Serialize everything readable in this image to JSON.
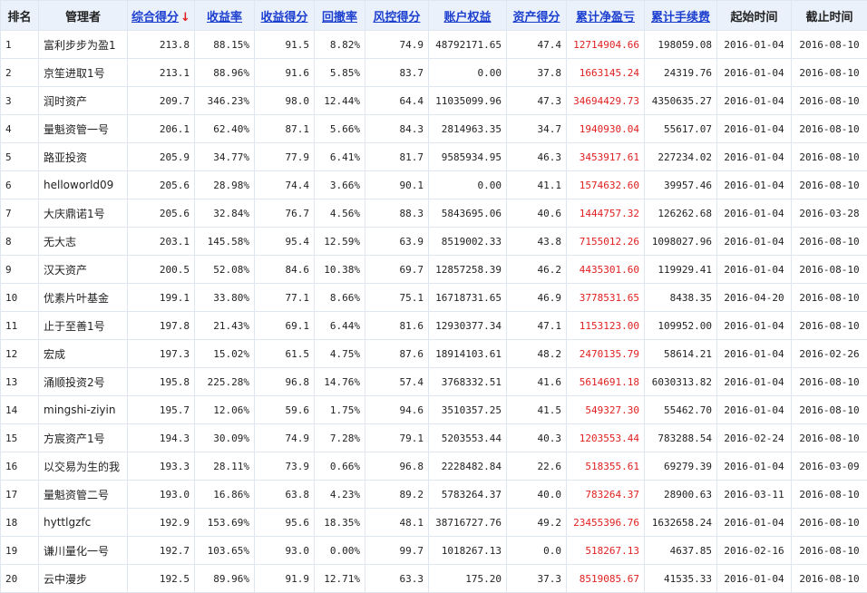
{
  "columns": [
    {
      "label": "排名",
      "sortable": false
    },
    {
      "label": "管理者",
      "sortable": false
    },
    {
      "label": "综合得分",
      "sortable": true,
      "active_sort": "desc"
    },
    {
      "label": "收益率",
      "sortable": true
    },
    {
      "label": "收益得分",
      "sortable": true
    },
    {
      "label": "回撤率",
      "sortable": true
    },
    {
      "label": "风控得分",
      "sortable": true
    },
    {
      "label": "账户权益",
      "sortable": true
    },
    {
      "label": "资产得分",
      "sortable": true
    },
    {
      "label": "累计净盈亏",
      "sortable": true
    },
    {
      "label": "累计手续费",
      "sortable": true
    },
    {
      "label": "起始时间",
      "sortable": false
    },
    {
      "label": "截止时间",
      "sortable": false
    }
  ],
  "sort_arrow": "↓",
  "colors": {
    "link": "#1d3fcf",
    "profit": "#e02020",
    "header_bg": "#eaf1fa",
    "border": "#dfe6ef"
  },
  "rows": [
    [
      "1",
      "富利步步为盈1",
      "213.8",
      "88.15%",
      "91.5",
      "8.82%",
      "74.9",
      "48792171.65",
      "47.4",
      "12714904.66",
      "198059.08",
      "2016-01-04",
      "2016-08-10"
    ],
    [
      "2",
      "京笙进取1号",
      "213.1",
      "88.96%",
      "91.6",
      "5.85%",
      "83.7",
      "0.00",
      "37.8",
      "1663145.24",
      "24319.76",
      "2016-01-04",
      "2016-08-10"
    ],
    [
      "3",
      "润时资产",
      "209.7",
      "346.23%",
      "98.0",
      "12.44%",
      "64.4",
      "11035099.96",
      "47.3",
      "34694429.73",
      "4350635.27",
      "2016-01-04",
      "2016-08-10"
    ],
    [
      "4",
      "量魁资管一号",
      "206.1",
      "62.40%",
      "87.1",
      "5.66%",
      "84.3",
      "2814963.35",
      "34.7",
      "1940930.04",
      "55617.07",
      "2016-01-04",
      "2016-08-10"
    ],
    [
      "5",
      "路亚投资",
      "205.9",
      "34.77%",
      "77.9",
      "6.41%",
      "81.7",
      "9585934.95",
      "46.3",
      "3453917.61",
      "227234.02",
      "2016-01-04",
      "2016-08-10"
    ],
    [
      "6",
      "helloworld09",
      "205.6",
      "28.98%",
      "74.4",
      "3.66%",
      "90.1",
      "0.00",
      "41.1",
      "1574632.60",
      "39957.46",
      "2016-01-04",
      "2016-08-10"
    ],
    [
      "7",
      "大庆鼎诺1号",
      "205.6",
      "32.84%",
      "76.7",
      "4.56%",
      "88.3",
      "5843695.06",
      "40.6",
      "1444757.32",
      "126262.68",
      "2016-01-04",
      "2016-03-28"
    ],
    [
      "8",
      "无大志",
      "203.1",
      "145.58%",
      "95.4",
      "12.59%",
      "63.9",
      "8519002.33",
      "43.8",
      "7155012.26",
      "1098027.96",
      "2016-01-04",
      "2016-08-10"
    ],
    [
      "9",
      "汉天资产",
      "200.5",
      "52.08%",
      "84.6",
      "10.38%",
      "69.7",
      "12857258.39",
      "46.2",
      "4435301.60",
      "119929.41",
      "2016-01-04",
      "2016-08-10"
    ],
    [
      "10",
      "优素片叶基金",
      "199.1",
      "33.80%",
      "77.1",
      "8.66%",
      "75.1",
      "16718731.65",
      "46.9",
      "3778531.65",
      "8438.35",
      "2016-04-20",
      "2016-08-10"
    ],
    [
      "11",
      "止于至善1号",
      "197.8",
      "21.43%",
      "69.1",
      "6.44%",
      "81.6",
      "12930377.34",
      "47.1",
      "1153123.00",
      "109952.00",
      "2016-01-04",
      "2016-08-10"
    ],
    [
      "12",
      "宏成",
      "197.3",
      "15.02%",
      "61.5",
      "4.75%",
      "87.6",
      "18914103.61",
      "48.2",
      "2470135.79",
      "58614.21",
      "2016-01-04",
      "2016-02-26"
    ],
    [
      "13",
      "涌顺投资2号",
      "195.8",
      "225.28%",
      "96.8",
      "14.76%",
      "57.4",
      "3768332.51",
      "41.6",
      "5614691.18",
      "6030313.82",
      "2016-01-04",
      "2016-08-10"
    ],
    [
      "14",
      "mingshi-ziyin",
      "195.7",
      "12.06%",
      "59.6",
      "1.75%",
      "94.6",
      "3510357.25",
      "41.5",
      "549327.30",
      "55462.70",
      "2016-01-04",
      "2016-08-10"
    ],
    [
      "15",
      "方宸资产1号",
      "194.3",
      "30.09%",
      "74.9",
      "7.28%",
      "79.1",
      "5203553.44",
      "40.3",
      "1203553.44",
      "783288.54",
      "2016-02-24",
      "2016-08-10"
    ],
    [
      "16",
      "以交易为生的我",
      "193.3",
      "28.11%",
      "73.9",
      "0.66%",
      "96.8",
      "2228482.84",
      "22.6",
      "518355.61",
      "69279.39",
      "2016-01-04",
      "2016-03-09"
    ],
    [
      "17",
      "量魁资管二号",
      "193.0",
      "16.86%",
      "63.8",
      "4.23%",
      "89.2",
      "5783264.37",
      "40.0",
      "783264.37",
      "28900.63",
      "2016-03-11",
      "2016-08-10"
    ],
    [
      "18",
      "hyttlgzfc",
      "192.9",
      "153.69%",
      "95.6",
      "18.35%",
      "48.1",
      "38716727.76",
      "49.2",
      "23455396.76",
      "1632658.24",
      "2016-01-04",
      "2016-08-10"
    ],
    [
      "19",
      "谦川量化一号",
      "192.7",
      "103.65%",
      "93.0",
      "0.00%",
      "99.7",
      "1018267.13",
      "0.0",
      "518267.13",
      "4637.85",
      "2016-02-16",
      "2016-08-10"
    ],
    [
      "20",
      "云中漫步",
      "192.5",
      "89.96%",
      "91.9",
      "12.71%",
      "63.3",
      "175.20",
      "37.3",
      "8519085.67",
      "41535.33",
      "2016-01-04",
      "2016-08-10"
    ]
  ]
}
